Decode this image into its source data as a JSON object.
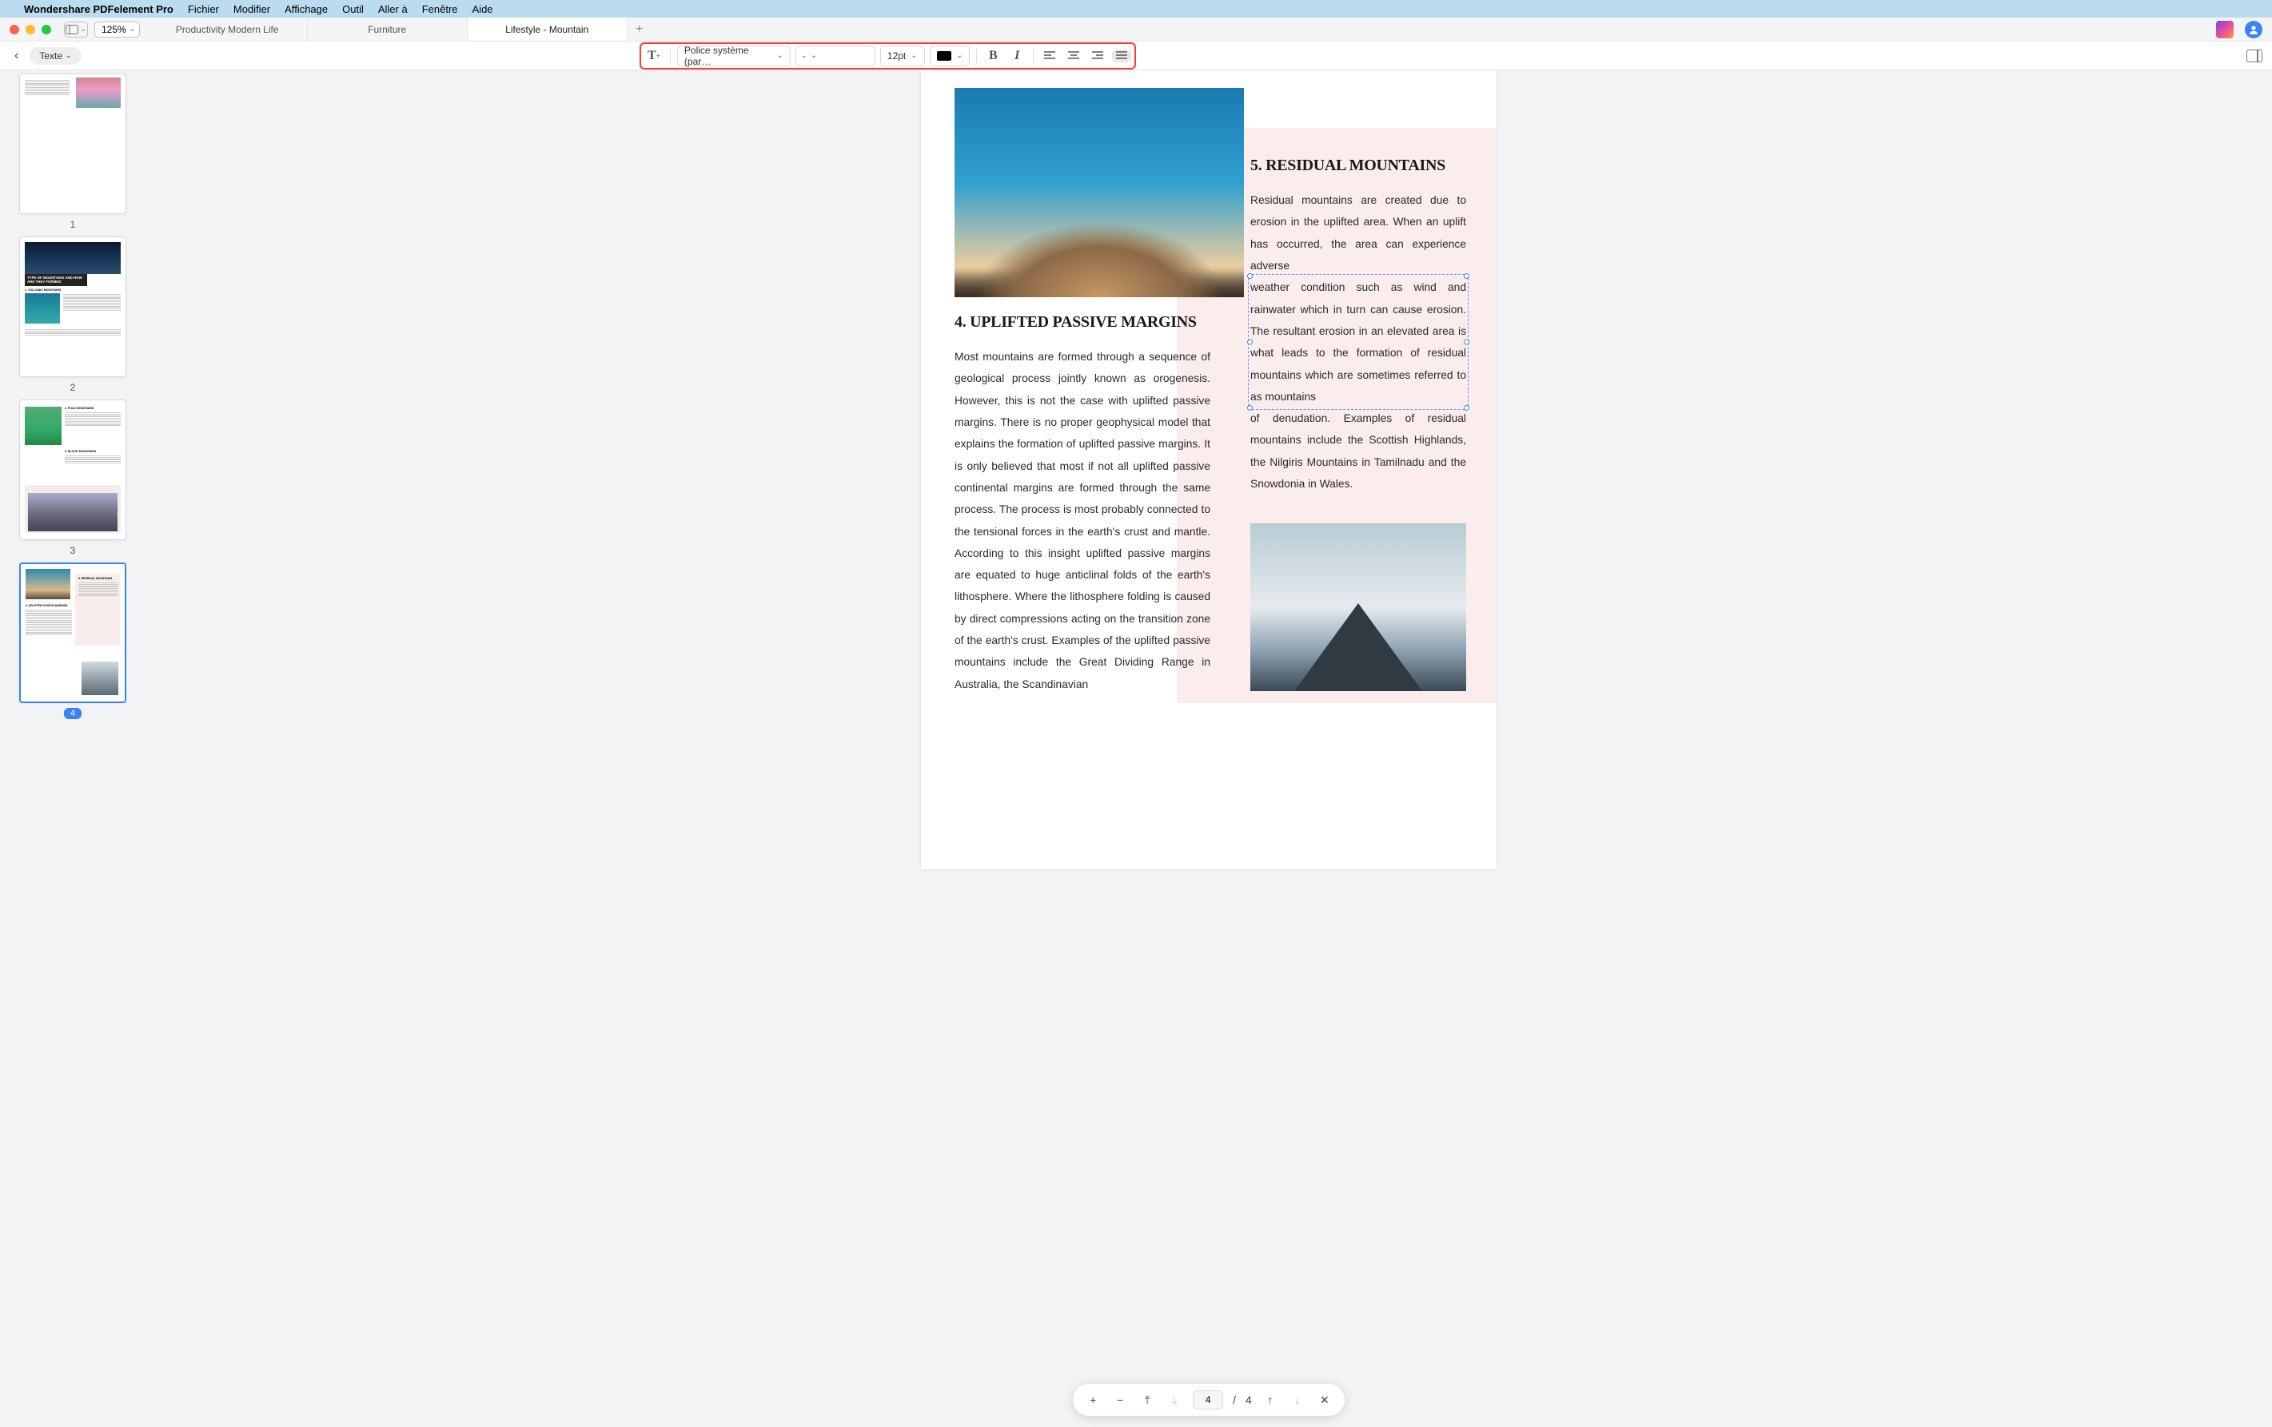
{
  "menubar": {
    "app": "Wondershare PDFelement Pro",
    "items": [
      "Fichier",
      "Modifier",
      "Affichage",
      "Outil",
      "Aller à",
      "Fenêtre",
      "Aide"
    ]
  },
  "titlebar": {
    "zoom": "125%",
    "tabs": [
      {
        "label": "Productivity Modern Life",
        "active": false
      },
      {
        "label": "Furniture",
        "active": false
      },
      {
        "label": "Lifestyle - Mountain",
        "active": true
      }
    ],
    "addtab": "+"
  },
  "toolbar": {
    "back": "‹",
    "texte": "Texte",
    "font_select": "Police système (par…",
    "style_select": "-",
    "size_select": "12pt",
    "color": "#000000",
    "bold": "B",
    "italic": "I"
  },
  "thumbs": [
    {
      "num": "1",
      "selected": false
    },
    {
      "num": "2",
      "selected": false
    },
    {
      "num": "3",
      "selected": false
    },
    {
      "num": "4",
      "selected": true
    }
  ],
  "page": {
    "h4": "4. UPLIFTED PASSIVE MARGINS",
    "body4": "Most mountains are formed through a sequence of geological process jointly known as orogenesis. However, this is not the case with uplifted passive margins. There is no proper geophysical model that explains the formation of uplifted passive margins. It is only believed that most if not all uplifted passive continental margins are formed through the same process. The process is most probably connected to the tensional forces in the earth's crust and mantle. According to this insight uplifted passive margins are equated to huge anticlinal folds of the earth's lithosphere. Where the lithosphere folding is caused by direct compressions acting on the transition zone of the earth's crust. Examples of the uplifted passive mountains include the Great Dividing Range in Australia, the Scandinavian",
    "h5": "5. RESIDUAL MOUNTAINS",
    "body5a": "Residual mountains are created due to erosion in the uplifted area. When an uplift has occurred, the area can experience adverse",
    "body5_sel": "weather condition such as wind and rainwater which in turn can cause erosion. The resultant erosion in an elevated area is what leads to the formation of residual mountains which are sometimes referred to as mountains",
    "body5b": "of denudation. Examples of residual mountains include the Scottish Highlands, the Nilgiris Mountains in Tamilnadu and the Snowdonia in Wales."
  },
  "bottombar": {
    "plus": "+",
    "minus": "−",
    "top": "⤒",
    "bottom": "⤓",
    "current": "4",
    "sep": "/",
    "total": "4",
    "up": "↑",
    "down": "↓",
    "close": "✕"
  },
  "thumb2": {
    "title1": "TYPE OF MOUNTAINS AND HOW",
    "title2": "ARE THEY FORMED",
    "sec1": "1. VOLCANIC MOUNTAINS"
  },
  "thumb3": {
    "sec2": "2. FOLD MOUNTAINS",
    "sec3": "3. BLOCK MOUNTAINS"
  },
  "thumb4": {
    "sec5": "5. RESIDUAL MOUNTAINS",
    "sec4": "4. UPLIFTED PASSIVE MARGINS"
  }
}
